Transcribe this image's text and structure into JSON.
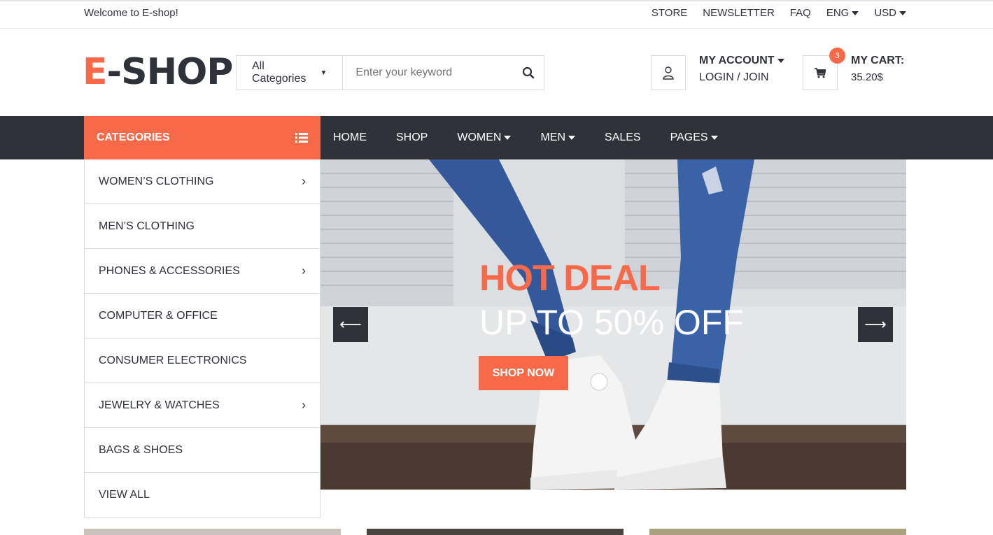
{
  "topbar": {
    "welcome": "Welcome to E-shop!",
    "links": {
      "store": "STORE",
      "newsletter": "NEWSLETTER",
      "faq": "FAQ",
      "lang": "ENG",
      "currency": "USD"
    }
  },
  "header": {
    "logo_e": "E",
    "logo_rest": "-SHOP",
    "search": {
      "category": "All Categories",
      "placeholder": "Enter your keyword"
    },
    "account": {
      "title": "MY ACCOUNT",
      "login": "LOGIN / JOIN"
    },
    "cart": {
      "title": "MY CART:",
      "total": "35.20$",
      "count": "3"
    }
  },
  "nav": {
    "categories_label": "CATEGORIES",
    "items": {
      "home": "HOME",
      "shop": "SHOP",
      "women": "WOMEN",
      "men": "MEN",
      "sales": "SALES",
      "pages": "PAGES"
    }
  },
  "categories": [
    {
      "label": "WOMEN’S CLOTHING",
      "has_sub": true
    },
    {
      "label": "MEN’S CLOTHING",
      "has_sub": false
    },
    {
      "label": "PHONES & ACCESSORIES",
      "has_sub": true
    },
    {
      "label": "COMPUTER & OFFICE",
      "has_sub": false
    },
    {
      "label": "CONSUMER ELECTRONICS",
      "has_sub": false
    },
    {
      "label": "JEWELRY & WATCHES",
      "has_sub": true
    },
    {
      "label": "BAGS & SHOES",
      "has_sub": false
    },
    {
      "label": "VIEW ALL",
      "has_sub": false
    }
  ],
  "banner": {
    "headline": "HOT DEAL",
    "subline": "UP TO 50% OFF",
    "cta": "SHOP NOW",
    "prev_icon": "arrow-left-icon",
    "next_icon": "arrow-right-icon"
  },
  "colors": {
    "accent": "#f8694a",
    "dark": "#30323a",
    "border": "#dadada"
  }
}
